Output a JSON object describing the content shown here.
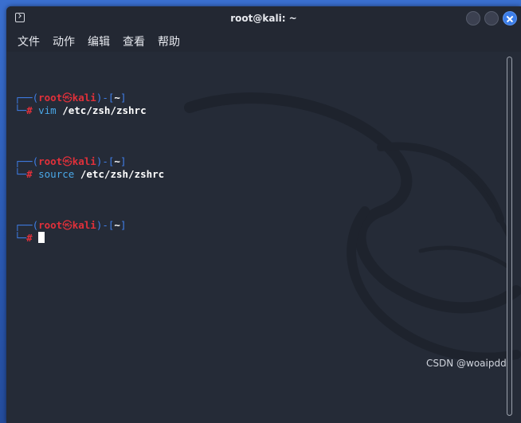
{
  "window": {
    "title": "root@kali: ~",
    "close_color": "#3b7de8"
  },
  "menubar": {
    "items": [
      "文件",
      "动作",
      "编辑",
      "查看",
      "帮助"
    ]
  },
  "terminal": {
    "prompts": [
      {
        "open": "┌──(",
        "user": "root",
        "at": "㉿",
        "host": "kali",
        "mid": ")-[",
        "dir": "~",
        "close": "]",
        "line2": "└─",
        "hash": "#",
        "command": "vim",
        "argument": "/etc/zsh/zshrc"
      },
      {
        "open": "┌──(",
        "user": "root",
        "at": "㉿",
        "host": "kali",
        "mid": ")-[",
        "dir": "~",
        "close": "]",
        "line2": "└─",
        "hash": "#",
        "command": "source",
        "argument": "/etc/zsh/zshrc"
      },
      {
        "open": "┌──(",
        "user": "root",
        "at": "㉿",
        "host": "kali",
        "mid": ")-[",
        "dir": "~",
        "close": "]",
        "line2": "└─",
        "hash": "#",
        "command": "",
        "argument": ""
      }
    ],
    "colors": {
      "frame": "#3f7ee8",
      "user": "#e0303a",
      "command": "#4aa8e8",
      "background": "#252b37"
    }
  },
  "watermark": "CSDN @woaipdd"
}
